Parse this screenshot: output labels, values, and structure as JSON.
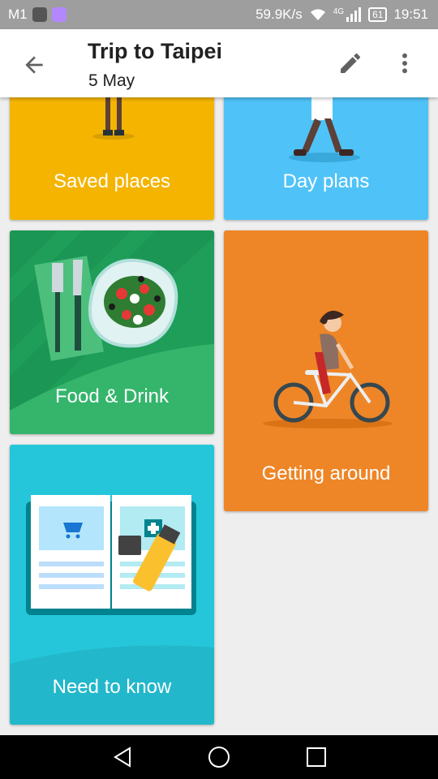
{
  "status_bar": {
    "carrier": "M1",
    "speed": "59.9K/s",
    "network": "4G",
    "battery": "61",
    "time": "19:51"
  },
  "app_bar": {
    "title": "Trip to Taipei",
    "subtitle": "5 May"
  },
  "cards": {
    "saved_places": "Saved places",
    "day_plans": "Day plans",
    "food_drink": "Food & Drink",
    "getting_around": "Getting around",
    "need_to_know": "Need to know"
  },
  "colors": {
    "saved_places": "#f4b400",
    "day_plans": "#4fc3f7",
    "food_drink": "#1e9e58",
    "getting_around": "#ee8627",
    "need_to_know": "#26c6da"
  }
}
